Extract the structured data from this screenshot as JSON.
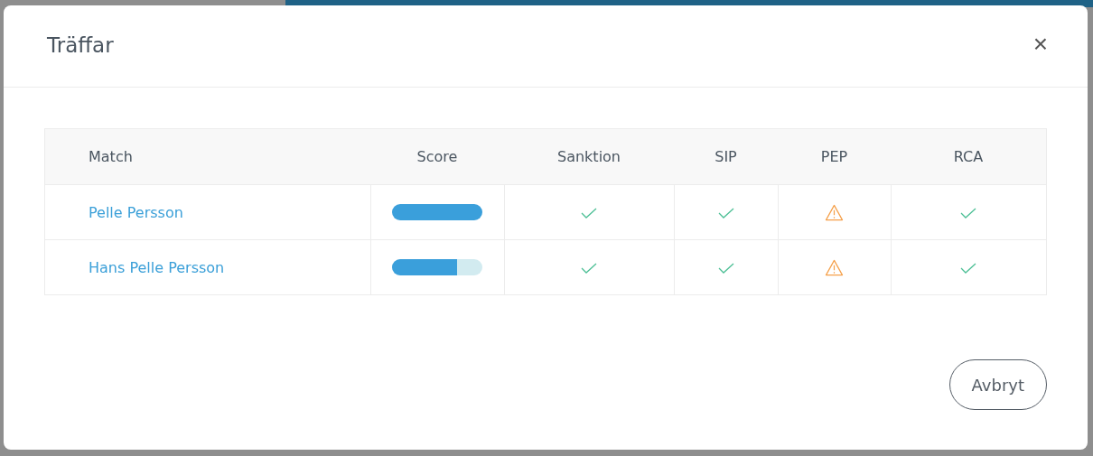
{
  "dialog": {
    "title": "Träffar",
    "close": "×"
  },
  "table": {
    "columns": [
      "Match",
      "Score",
      "Sanktion",
      "SIP",
      "PEP",
      "RCA"
    ],
    "rows": [
      {
        "match": "Pelle Persson",
        "score": {
          "level": 1.0
        },
        "checks": [
          {
            "kind": "ok"
          },
          {
            "kind": "ok"
          },
          {
            "kind": "warning"
          },
          {
            "kind": "ok"
          }
        ]
      },
      {
        "match": "Hans Pelle Persson",
        "score": {
          "level": 0.72
        },
        "checks": [
          {
            "kind": "ok"
          },
          {
            "kind": "ok"
          },
          {
            "kind": "warning"
          },
          {
            "kind": "ok"
          }
        ]
      }
    ]
  },
  "buttons": [
    "Avbryt"
  ]
}
